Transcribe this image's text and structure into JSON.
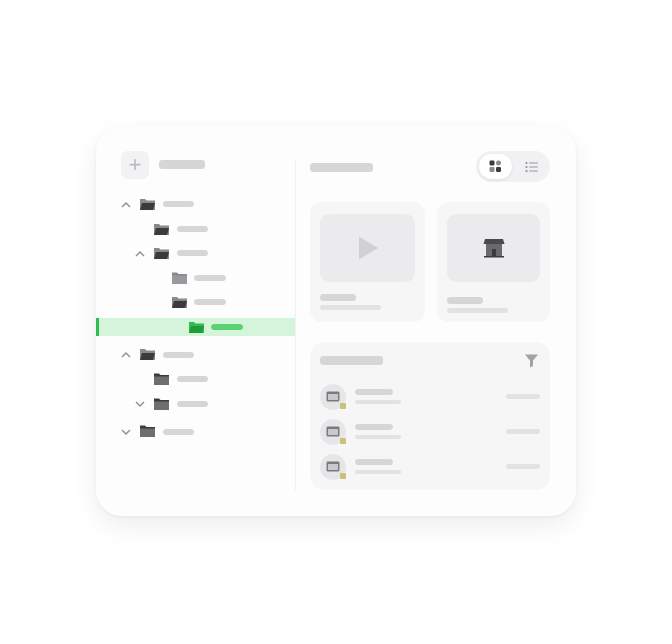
{
  "colors": {
    "accent": "#2fbe4d",
    "selection": "#d4f5d9",
    "placeholder": "#d6d6d8",
    "folder_dark": "#3b3b3f",
    "folder_mid": "#8a8a8e"
  },
  "sidebar": {
    "add_icon": "plus-icon",
    "tree": [
      {
        "depth": 0,
        "chevron": "chevron-up-icon",
        "icon": "folder-open-icon"
      },
      {
        "depth": 1,
        "chevron": "none",
        "icon": "folder-open-icon"
      },
      {
        "depth": 1,
        "chevron": "chevron-up-icon",
        "icon": "folder-open-icon"
      },
      {
        "depth": 2,
        "chevron": "none",
        "icon": "folder-icon"
      },
      {
        "depth": 2,
        "chevron": "none",
        "icon": "folder-open-icon"
      },
      {
        "depth": 3,
        "chevron": "none",
        "icon": "folder-open-icon",
        "selected": true
      },
      {
        "depth": 0,
        "chevron": "chevron-up-icon",
        "icon": "folder-open-icon"
      },
      {
        "depth": 1,
        "chevron": "none",
        "icon": "folder-icon"
      },
      {
        "depth": 1,
        "chevron": "chevron-down-icon",
        "icon": "folder-icon"
      },
      {
        "depth": 0,
        "chevron": "chevron-down-icon",
        "icon": "folder-icon"
      }
    ]
  },
  "main": {
    "view_toggle": {
      "active": "grid-view-icon",
      "inactive": "list-view-icon"
    },
    "tiles": [
      {
        "icon": "play-icon"
      },
      {
        "icon": "store-icon"
      }
    ],
    "panel": {
      "filter_icon": "filter-icon",
      "rows": [
        {
          "icon": "window-icon"
        },
        {
          "icon": "window-icon"
        },
        {
          "icon": "window-icon"
        }
      ]
    }
  }
}
